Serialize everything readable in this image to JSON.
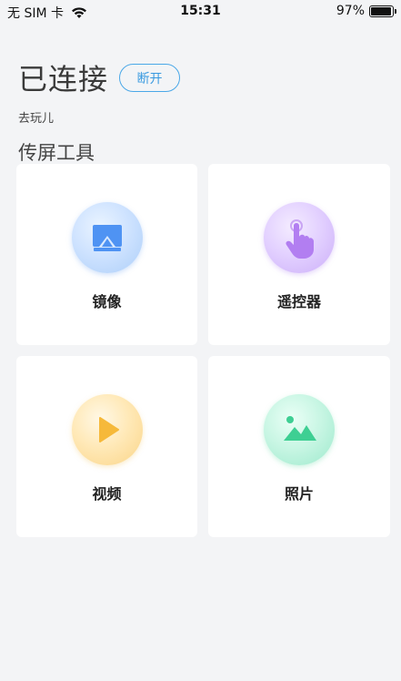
{
  "status_bar": {
    "carrier": "无 SIM 卡",
    "time": "15:31",
    "battery": "97%",
    "battery_level": 0.97
  },
  "connection": {
    "status": "已连接",
    "disconnect_label": "断开",
    "sub_link": "去玩儿"
  },
  "section": {
    "title": "传屏工具"
  },
  "tools": [
    {
      "label": "镜像",
      "icon": "screen-mirror-icon",
      "color": "#5b9cf6"
    },
    {
      "label": "遥控器",
      "icon": "hand-pointer-icon",
      "color": "#b585f2"
    },
    {
      "label": "视频",
      "icon": "play-icon",
      "color": "#f7be45"
    },
    {
      "label": "照片",
      "icon": "picture-icon",
      "color": "#45d79d"
    }
  ]
}
